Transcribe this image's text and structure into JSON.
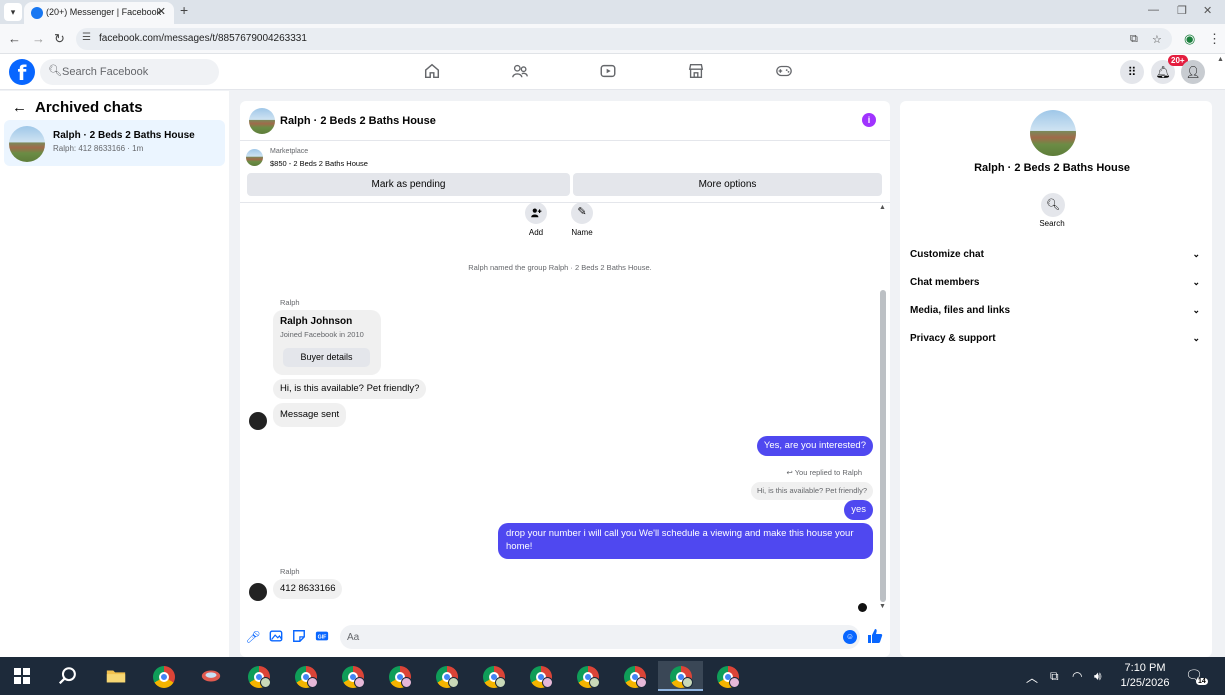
{
  "browser": {
    "tab_title": "(20+) Messenger | Facebook",
    "url": "facebook.com/messages/t/8857679004263331"
  },
  "fb": {
    "search_placeholder": "Search Facebook",
    "notif_badge": "20+"
  },
  "left": {
    "header": "Archived chats",
    "chat": {
      "name": "Ralph · 2 Beds 2 Baths House",
      "preview": "Ralph: 412 8633166 · 1m"
    }
  },
  "chat": {
    "title": "Ralph · 2 Beds 2 Baths House",
    "marketplace_label": "Marketplace",
    "listing": "$850 - 2 Beds 2 Baths House",
    "mark_pending": "Mark as pending",
    "more_options": "More options",
    "quick_actions": [
      {
        "label": "Add"
      },
      {
        "label": "Name"
      }
    ],
    "system_msg": "Ralph named the group Ralph · 2 Beds 2 Baths House.",
    "sender_1": "Ralph",
    "buyer": {
      "name": "Ralph Johnson",
      "joined": "Joined Facebook in 2010",
      "button": "Buyer details"
    },
    "in_1": "Hi, is this available? Pet friendly?",
    "in_2": "Message sent",
    "out_1": "Yes, are you interested?",
    "replied_label": "You replied to Ralph",
    "reply_quote": "Hi, is this available? Pet friendly?",
    "out_2": "yes",
    "out_3": "drop your number i will call you We'll schedule a viewing and make this house your home!",
    "sender_2": "Ralph",
    "in_3": "412 8633166",
    "composer_placeholder": "Aa"
  },
  "right": {
    "name": "Ralph · 2 Beds 2 Baths House",
    "search_label": "Search",
    "sections": [
      "Customize chat",
      "Chat members",
      "Media, files and links",
      "Privacy & support"
    ]
  },
  "taskbar": {
    "time": "7:10 PM",
    "date": "1/25/2026",
    "notif_count": "14"
  }
}
